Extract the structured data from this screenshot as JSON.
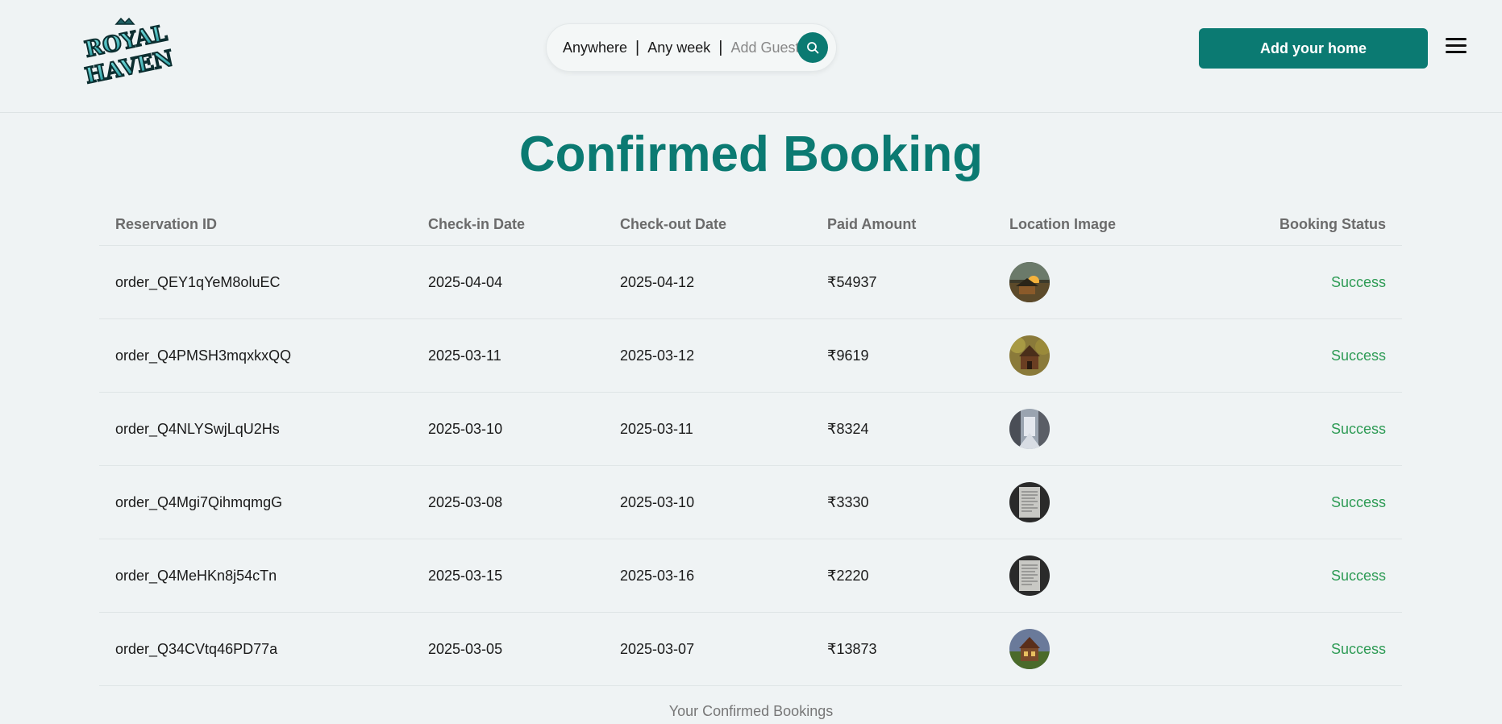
{
  "header": {
    "logo_text": "ROYAL HAVEN",
    "search": {
      "location": "Anywhere",
      "separator": "|",
      "week": "Any week",
      "guest": "Add Guest"
    },
    "add_home_label": "Add your home"
  },
  "page_title": "Confirmed Booking",
  "table": {
    "columns": [
      "Reservation ID",
      "Check-in Date",
      "Check-out Date",
      "Paid Amount",
      "Location Image",
      "Booking Status"
    ],
    "rows": [
      {
        "id": "order_QEY1qYeM8oluEC",
        "checkin": "2025-04-04",
        "checkout": "2025-04-12",
        "amount": "₹54937",
        "image": "sunset-cabin-image",
        "status": "Success"
      },
      {
        "id": "order_Q4PMSH3mqxkxQQ",
        "checkin": "2025-03-11",
        "checkout": "2025-03-12",
        "amount": "₹9619",
        "image": "wooden-house-image",
        "status": "Success"
      },
      {
        "id": "order_Q4NLYSwjLqU2Hs",
        "checkin": "2025-03-10",
        "checkout": "2025-03-11",
        "amount": "₹8324",
        "image": "snowy-villa-image",
        "status": "Success"
      },
      {
        "id": "order_Q4Mgi7QihmqmgG",
        "checkin": "2025-03-08",
        "checkout": "2025-03-10",
        "amount": "₹3330",
        "image": "document-image",
        "status": "Success"
      },
      {
        "id": "order_Q4MeHKn8j54cTn",
        "checkin": "2025-03-15",
        "checkout": "2025-03-16",
        "amount": "₹2220",
        "image": "document-image",
        "status": "Success"
      },
      {
        "id": "order_Q34CVtq46PD77a",
        "checkin": "2025-03-05",
        "checkout": "2025-03-07",
        "amount": "₹13873",
        "image": "garden-house-image",
        "status": "Success"
      }
    ]
  },
  "footer_note": "Your Confirmed Bookings",
  "colors": {
    "accent": "#0b7a72",
    "background": "#eff3f4",
    "success": "#2e9b55"
  }
}
